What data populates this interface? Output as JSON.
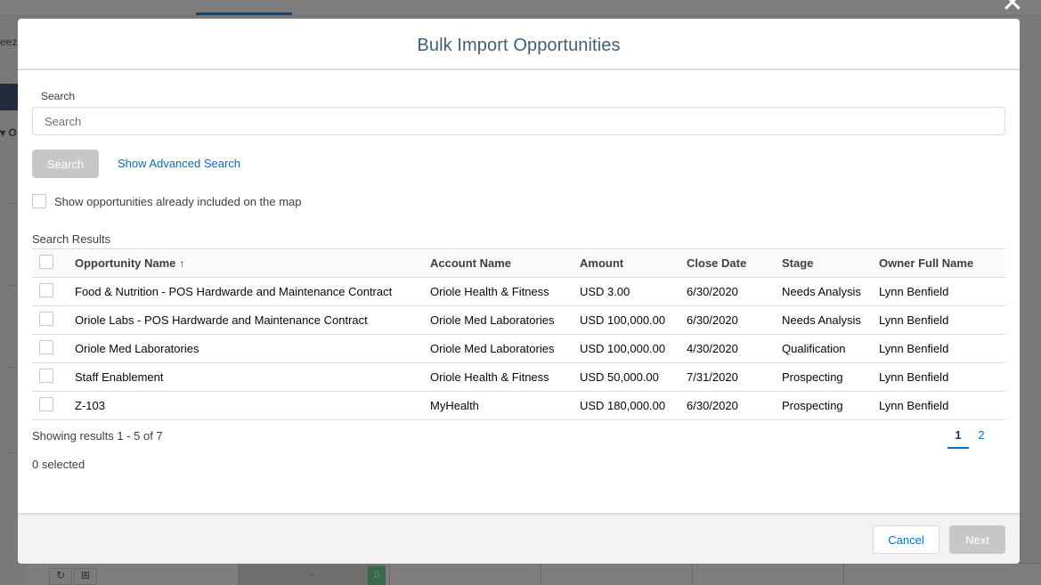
{
  "background": {
    "partial_text": "eez",
    "partial_label": "O"
  },
  "modal": {
    "title": "Bulk Import Opportunities",
    "search": {
      "label": "Search",
      "placeholder": "Search",
      "value": ""
    },
    "search_button": "Search",
    "advanced_link": "Show Advanced Search",
    "show_existing_label": "Show opportunities already included on the map",
    "results_label": "Search Results",
    "table": {
      "columns": [
        "Opportunity Name",
        "Account Name",
        "Amount",
        "Close Date",
        "Stage",
        "Owner Full Name"
      ],
      "rows": [
        [
          "Food & Nutrition - POS Hardwarde and Maintenance Contract",
          "Oriole Health & Fitness",
          "USD 3.00",
          "6/30/2020",
          "Needs Analysis",
          "Lynn Benfield"
        ],
        [
          "Oriole Labs - POS Hardwarde and Maintenance Contract",
          "Oriole Med Laboratories",
          "USD 100,000.00",
          "6/30/2020",
          "Needs Analysis",
          "Lynn Benfield"
        ],
        [
          "Oriole Med Laboratories",
          "Oriole Med Laboratories",
          "USD 100,000.00",
          "4/30/2020",
          "Qualification",
          "Lynn Benfield"
        ],
        [
          "Staff Enablement",
          "Oriole Health & Fitness",
          "USD 50,000.00",
          "7/31/2020",
          "Prospecting",
          "Lynn Benfield"
        ],
        [
          "Z-103",
          "MyHealth",
          "USD 180,000.00",
          "6/30/2020",
          "Prospecting",
          "Lynn Benfield"
        ]
      ]
    },
    "showing_text": "Showing results 1 - 5 of 7",
    "selected_text": "0 selected",
    "pages": [
      "1",
      "2"
    ],
    "current_page": "1",
    "cancel_button": "Cancel",
    "next_button": "Next"
  },
  "colors": {
    "link": "#006dcc",
    "disabled_button": "#c9c7c5",
    "title": "#3e5f77"
  }
}
